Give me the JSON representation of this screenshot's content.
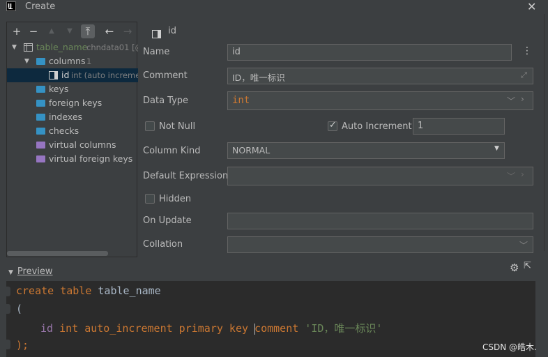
{
  "window": {
    "title": "Create",
    "app_icon_text": "IJ"
  },
  "toolbar": {
    "add": "+",
    "remove": "−",
    "up": "▲",
    "down": "▼",
    "pin": "⤒",
    "back": "←",
    "forward": "→"
  },
  "tree": {
    "table_name": "table_name",
    "table_schema": "chndata01 [@",
    "columns_label": "columns",
    "columns_count": "1",
    "column_id": "id",
    "column_id_type": "int (auto incremen",
    "keys": "keys",
    "foreign_keys": "foreign keys",
    "indexes": "indexes",
    "checks": "checks",
    "virtual_columns": "virtual columns",
    "virtual_foreign_keys": "virtual foreign keys"
  },
  "form": {
    "header": "id",
    "name_label": "Name",
    "name_value": "id",
    "comment_label": "Comment",
    "comment_value": "ID，唯一标识",
    "datatype_label": "Data Type",
    "datatype_value": "int",
    "notnull_label": "Not Null",
    "notnull_checked": false,
    "autoinc_label": "Auto Increment",
    "autoinc_checked": true,
    "autoinc_value": "1",
    "columnkind_label": "Column Kind",
    "columnkind_value": "NORMAL",
    "default_label": "Default Expression",
    "default_value": "",
    "hidden_label": "Hidden",
    "hidden_checked": false,
    "onupdate_label": "On Update",
    "onupdate_value": "",
    "collation_label": "Collation",
    "collation_value": ""
  },
  "preview": {
    "title": "Preview",
    "line1_kw": "create table",
    "line1_name": " table_name",
    "line2": "(",
    "line3_col": "id",
    "line3_kw1": " int auto_increment primary key ",
    "line3_kw2": "comment",
    "line3_str": " 'ID，唯一标识'",
    "line4": ");"
  },
  "watermark": "CSDN @皓木.",
  "colors": {
    "background": "#3c3f41",
    "editor_bg": "#2b2b2b",
    "keyword": "#cc7832",
    "string": "#6a8759",
    "column": "#9876aa",
    "folder_blue": "#3592c4",
    "folder_purple": "#9675c1"
  }
}
